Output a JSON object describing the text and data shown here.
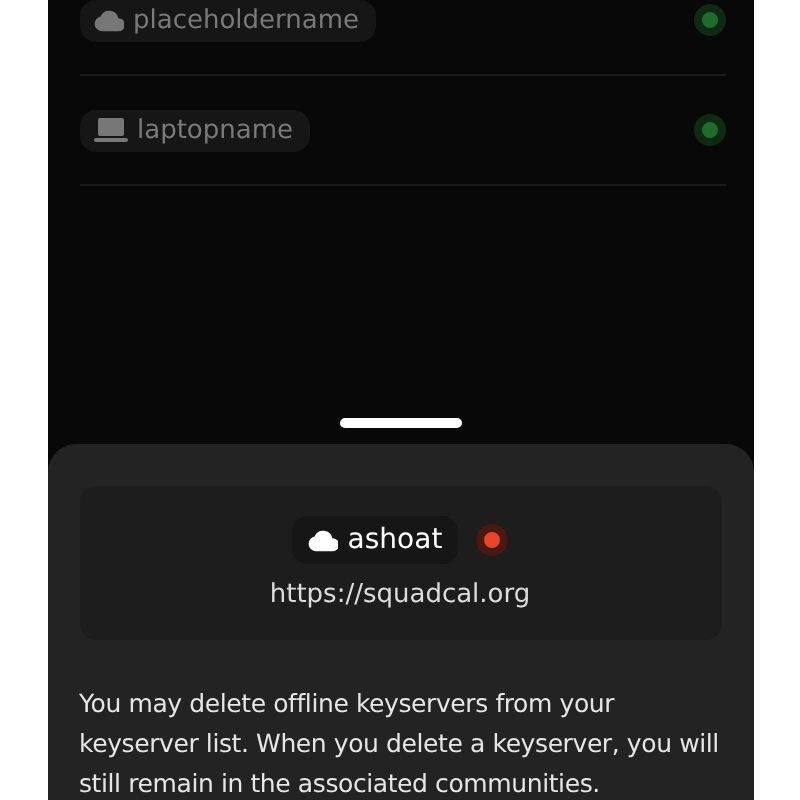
{
  "keyservers": [
    {
      "name": "placeholdername",
      "kind": "cloud",
      "online": true
    },
    {
      "name": "laptopname",
      "kind": "laptop",
      "online": true
    }
  ],
  "sheet": {
    "keyserver": {
      "name": "ashoat",
      "kind": "cloud",
      "online": false,
      "url": "https://squadcal.org"
    },
    "description": "You may delete offline keyservers from your keyserver list. When you delete a keyserver, you will still remain in the associated communities."
  }
}
